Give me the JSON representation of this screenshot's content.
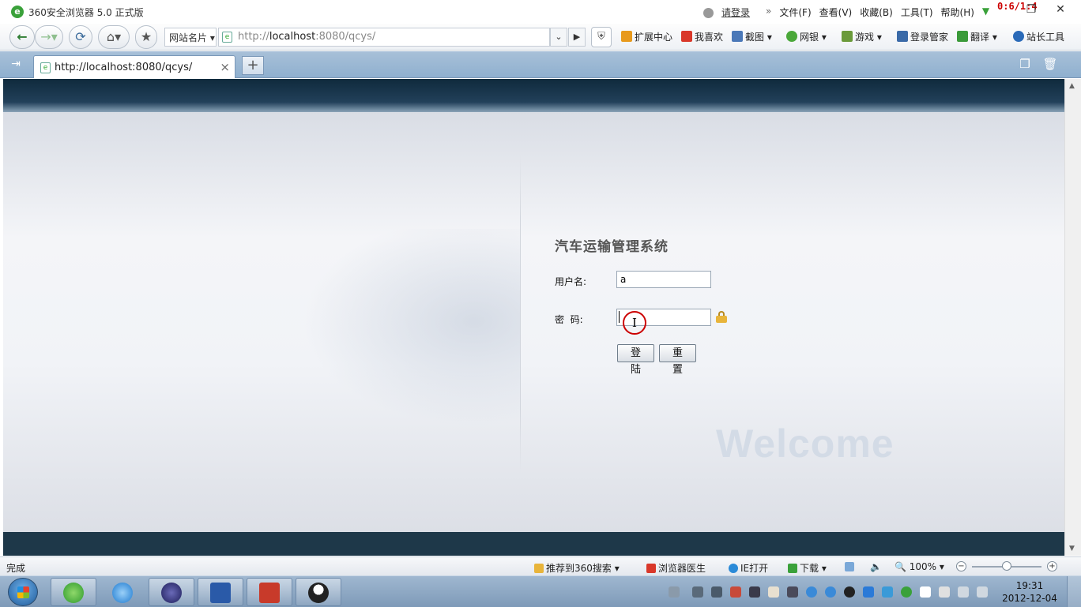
{
  "browser": {
    "title": "360安全浏览器 5.0 正式版",
    "timer": "0:6/1:4",
    "menus": {
      "login": "请登录",
      "file": "文件(F)",
      "view": "查看(V)",
      "favorites": "收藏(B)",
      "tools": "工具(T)",
      "help": "帮助(H)"
    }
  },
  "toolbar": {
    "site_card": "网站名片",
    "address": {
      "prefix": "http://",
      "host": "localhost",
      "suffix": ":8080/qcys/"
    },
    "items": {
      "extensions": "扩展中心",
      "likes": "我喜欢",
      "screenshot": "截图",
      "bank": "网银",
      "games": "游戏",
      "login_manager": "登录管家",
      "translate": "翻译",
      "webmaster": "站长工具"
    }
  },
  "tabs": [
    {
      "label": "http://localhost:8080/qcys/",
      "active": true
    }
  ],
  "page": {
    "system_title": "汽车运输管理系统",
    "username_label": "用户名:",
    "username_value": "a",
    "password_label": "密  码:",
    "password_value": "",
    "login_button": "登 陆",
    "reset_button": "重 置",
    "watermark": "Welcome"
  },
  "statusbar": {
    "status": "完成",
    "recommend": "推荐到360搜索",
    "doctor": "浏览器医生",
    "ie_open": "IE打开",
    "download": "下载",
    "zoom": "100%",
    "zoom_level": 0.5
  },
  "taskbar": {
    "time": "19:31",
    "date": "2012-12-04",
    "apps": [
      "360browser",
      "internet-explorer",
      "eclipse",
      "word",
      "toolbox",
      "qq"
    ]
  },
  "colors": {
    "header_dark": "#1e3849",
    "accent_red": "#cc0000",
    "tab_strip": "#9ab6d2"
  }
}
